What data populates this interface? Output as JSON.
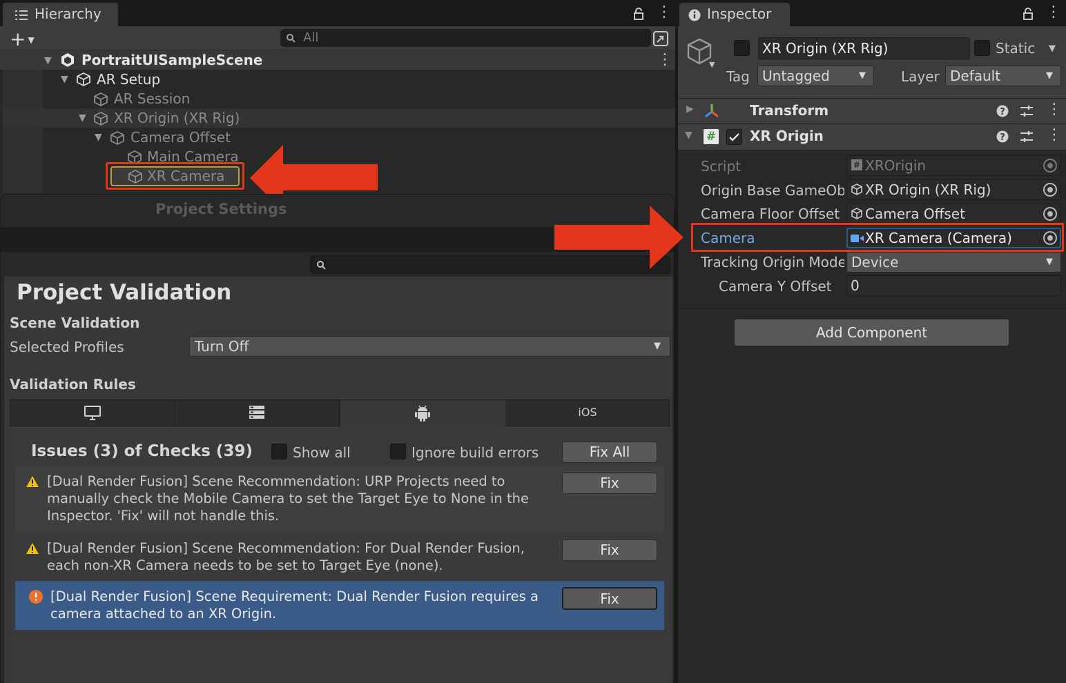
{
  "hierarchy": {
    "tab_label": "Hierarchy",
    "add_symbol": "+",
    "search_placeholder": "All",
    "scene_name": "PortraitUISampleScene",
    "items": [
      "AR Setup",
      "AR Session",
      "XR Origin (XR Rig)",
      "Camera Offset",
      "Main Camera",
      "XR Camera"
    ]
  },
  "project_settings": {
    "window_title": "Project Settings",
    "page_title": "Project Validation",
    "scene_validation_heading": "Scene Validation",
    "selected_profiles_label": "Selected Profiles",
    "selected_profiles_value": "Turn Off",
    "validation_rules_heading": "Validation Rules",
    "platform_tabs": [
      {
        "icon": "monitor-icon"
      },
      {
        "icon": "server-icon"
      },
      {
        "icon": "android-icon",
        "selected": true
      },
      {
        "label": "iOS"
      }
    ],
    "issues_summary": "Issues (3) of Checks (39)",
    "show_all_label": "Show all",
    "ignore_build_errors_label": "Ignore build errors",
    "fix_all_label": "Fix All",
    "issues": [
      {
        "severity": "warning",
        "text": "[Dual Render Fusion] Scene Recommendation: URP Projects need to manually check the Mobile Camera to set the Target Eye to None in the Inspector. 'Fix' will not handle this.",
        "fix_label": "Fix"
      },
      {
        "severity": "warning",
        "text": "[Dual Render Fusion] Scene Recommendation: For Dual Render Fusion, each non-XR Camera needs to be set to Target Eye (none).",
        "fix_label": "Fix"
      },
      {
        "severity": "error",
        "text": "[Dual Render Fusion] Scene Requirement: Dual Render Fusion requires a camera attached to an XR Origin.",
        "fix_label": "Fix",
        "selected": true
      }
    ]
  },
  "inspector": {
    "tab_label": "Inspector",
    "object_name": "XR Origin (XR Rig)",
    "static_label": "Static",
    "tag_label": "Tag",
    "tag_value": "Untagged",
    "layer_label": "Layer",
    "layer_value": "Default",
    "transform_label": "Transform",
    "component_label": "XR Origin",
    "fields": {
      "script": {
        "label": "Script",
        "value": "XROrigin"
      },
      "origin_base": {
        "label": "Origin Base GameObj",
        "value": "XR Origin (XR Rig)"
      },
      "camera_floor": {
        "label": "Camera Floor Offset (",
        "value": "Camera Offset"
      },
      "camera": {
        "label": "Camera",
        "value": "XR Camera (Camera)"
      },
      "tracking": {
        "label": "Tracking Origin Mode",
        "value": "Device"
      },
      "camera_y": {
        "label": "Camera Y Offset",
        "value": "0"
      }
    },
    "add_component_label": "Add Component"
  },
  "colors": {
    "highlight_red": "#e3361a",
    "selection_blue": "#2c5d87",
    "issue_selected": "#3a5a88",
    "label_blue": "#7ba6e6"
  }
}
